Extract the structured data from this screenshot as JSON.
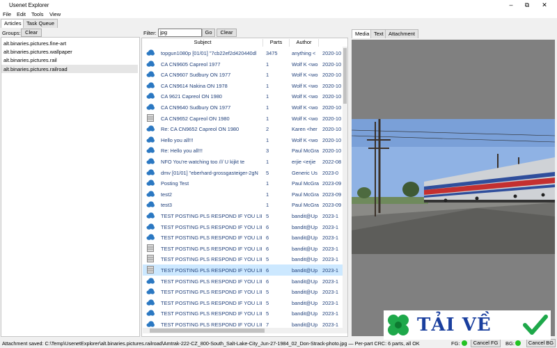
{
  "window": {
    "title": "Usenet Explorer"
  },
  "menu": [
    "File",
    "Edit",
    "Tools",
    "View"
  ],
  "tabs": [
    "Articles",
    "Task Queue"
  ],
  "groups": {
    "label": "Groups:",
    "clear_label": "Clear",
    "items": [
      "alt.binaries.pictures.fine-art",
      "alt.binaries.pictures.wallpaper",
      "alt.binaries.pictures.rail",
      "alt.binaries.pictures.railroad"
    ]
  },
  "filter": {
    "label": "Filter:",
    "value": "jpg",
    "go_label": "Go",
    "clear_label": "Clear"
  },
  "columns": [
    "Subject",
    "Parts",
    "Author"
  ],
  "articles": [
    {
      "subject": "topgun1080p [01/01] \"7cb22ef2d420440dl",
      "parts": "3475",
      "author": "anything <",
      "date": "2020-10",
      "icon": "cloud-icon"
    },
    {
      "subject": "CA CN9605 Capreol 1977",
      "parts": "1",
      "author": "Wolf K <wo",
      "date": "2020-10",
      "icon": "cloud-icon"
    },
    {
      "subject": "CA CN9607 Sudbury ON 1977",
      "parts": "1",
      "author": "Wolf K <wo",
      "date": "2020-10",
      "icon": "cloud-icon"
    },
    {
      "subject": "CA CN9614 Nakina ON 1978",
      "parts": "1",
      "author": "Wolf K <wo",
      "date": "2020-10",
      "icon": "cloud-icon"
    },
    {
      "subject": "CA 9621 Capreol ON 1980",
      "parts": "1",
      "author": "Wolf K <wo",
      "date": "2020-10",
      "icon": "cloud-icon"
    },
    {
      "subject": "CA CN9640 Sudbury ON 1977",
      "parts": "1",
      "author": "Wolf K <wo",
      "date": "2020-10",
      "icon": "cloud-icon"
    },
    {
      "subject": "CA CN9652 Capreol ON 1980",
      "parts": "1",
      "author": "Wolf K <wo",
      "date": "2020-10",
      "icon": "box-icon"
    },
    {
      "subject": "Re: CA CN9652 Capreol ON 1980",
      "parts": "2",
      "author": "Karen <her",
      "date": "2020-10",
      "icon": "cloud-icon"
    },
    {
      "subject": "Hello you all!!!",
      "parts": "1",
      "author": "Wolf K <wo",
      "date": "2020-10",
      "icon": "cloud-icon"
    },
    {
      "subject": "Re: Hello you all!!!",
      "parts": "3",
      "author": "Paul McGra",
      "date": "2020-10",
      "icon": "cloud-icon"
    },
    {
      "subject": "NFO     You're watching too   ///   U kijkt te",
      "parts": "1",
      "author": "erjie <erjie",
      "date": "2022-08",
      "icon": "cloud-icon"
    },
    {
      "subject": "dmv [01/01] \"eberhard-grossgasteiger-2gN",
      "parts": "5",
      "author": "Generic Us",
      "date": "2023-0",
      "icon": "cloud-icon"
    },
    {
      "subject": "Posting Test",
      "parts": "1",
      "author": "Paul McGra",
      "date": "2023-09",
      "icon": "cloud-icon"
    },
    {
      "subject": "test2",
      "parts": "1",
      "author": "Paul McGra",
      "date": "2023-09",
      "icon": "cloud-icon"
    },
    {
      "subject": "test3",
      "parts": "1",
      "author": "Paul McGra",
      "date": "2023-09",
      "icon": "cloud-icon"
    },
    {
      "subject": "TEST POSTING PLS RESPOND IF YOU LIKE -",
      "parts": "5",
      "author": "bandit@Up",
      "date": "2023-1",
      "icon": "cloud-icon"
    },
    {
      "subject": "TEST POSTING PLS RESPOND IF YOU LIKE -",
      "parts": "6",
      "author": "bandit@Up",
      "date": "2023-1",
      "icon": "cloud-icon"
    },
    {
      "subject": "TEST POSTING PLS RESPOND IF YOU LIKE -",
      "parts": "6",
      "author": "bandit@Up",
      "date": "2023-1",
      "icon": "cloud-icon"
    },
    {
      "subject": "TEST POSTING PLS RESPOND IF YOU LIKE -",
      "parts": "6",
      "author": "bandit@Up",
      "date": "2023-1",
      "icon": "box-icon"
    },
    {
      "subject": "TEST POSTING PLS RESPOND IF YOU LIKE -",
      "parts": "5",
      "author": "bandit@Up",
      "date": "2023-1",
      "icon": "box-icon"
    },
    {
      "subject": "TEST POSTING PLS RESPOND IF YOU LIKE -",
      "parts": "6",
      "author": "bandit@Up",
      "date": "2023-1",
      "icon": "box-icon"
    },
    {
      "subject": "TEST POSTING PLS RESPOND IF YOU LIKE -",
      "parts": "6",
      "author": "bandit@Up",
      "date": "2023-1",
      "icon": "cloud-icon"
    },
    {
      "subject": "TEST POSTING PLS RESPOND IF YOU LIKE -",
      "parts": "5",
      "author": "bandit@Up",
      "date": "2023-1",
      "icon": "cloud-icon"
    },
    {
      "subject": "TEST POSTING PLS RESPOND IF YOU LIKE -",
      "parts": "5",
      "author": "bandit@Up",
      "date": "2023-1",
      "icon": "cloud-icon"
    },
    {
      "subject": "TEST POSTING PLS RESPOND IF YOU LIKE -",
      "parts": "5",
      "author": "bandit@Up",
      "date": "2023-1",
      "icon": "cloud-icon"
    },
    {
      "subject": "TEST POSTING PLS RESPOND IF YOU LIKE -",
      "parts": "7",
      "author": "bandit@Up",
      "date": "2023-1",
      "icon": "cloud-icon"
    }
  ],
  "selected_row": 20,
  "media_tabs": [
    "Media",
    "Text",
    "Attachment"
  ],
  "status": {
    "text": "Attachment saved: C:\\Temp\\UsenetExplorer\\alt.binaries.pictures.railroad\\Amtrak-222-CZ_800-South_Salt-Lake-City_Jun-27-1984_02_Don-Strack-photo.jpg — Per-part CRC: 6 parts, all OK",
    "fg_label": "FG:",
    "cancel_fg": "Cancel FG",
    "bg_label": "BG:",
    "cancel_bg": "Cancel BG"
  },
  "watermark": "TẢI VỀ",
  "colors": {
    "selection": "#cce8ff",
    "cloud": "#2b78c2",
    "status_ok": "#22c322",
    "link_text": "#1f3f7a"
  }
}
